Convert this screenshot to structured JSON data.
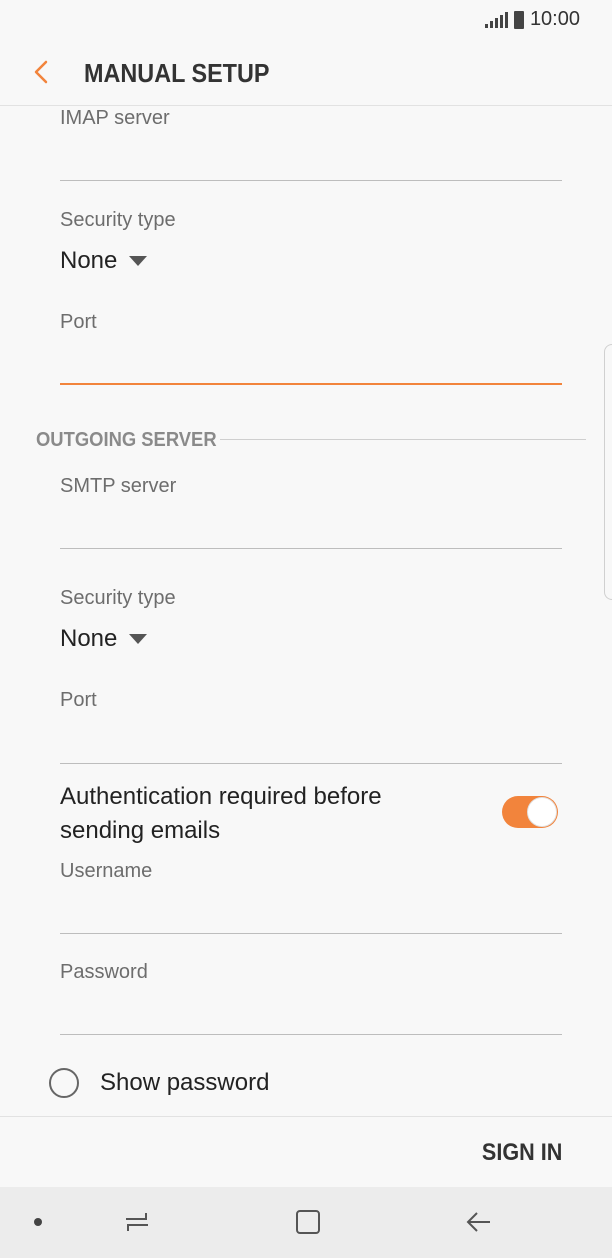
{
  "status_bar": {
    "time": "10:00"
  },
  "app_bar": {
    "title": "MANUAL SETUP"
  },
  "incoming": {
    "imap_label": "IMAP server",
    "security_label": "Security type",
    "security_value": "None",
    "port_label": "Port"
  },
  "outgoing": {
    "section_title": "OUTGOING SERVER",
    "smtp_label": "SMTP server",
    "security_label": "Security type",
    "security_value": "None",
    "port_label": "Port",
    "auth_label": "Authentication required before sending emails",
    "auth_enabled": true,
    "username_label": "Username",
    "password_label": "Password"
  },
  "show_password": {
    "label": "Show password",
    "checked": false
  },
  "actions": {
    "sign_in_label": "SIGN IN"
  },
  "colors": {
    "accent": "#f2843c",
    "background": "#f8f8f8",
    "nav_background": "#ececec"
  },
  "icons": [
    "back-arrow-icon",
    "signal-icon",
    "battery-icon",
    "dropdown-arrow-icon",
    "recent-apps-icon",
    "home-icon",
    "back-icon"
  ]
}
